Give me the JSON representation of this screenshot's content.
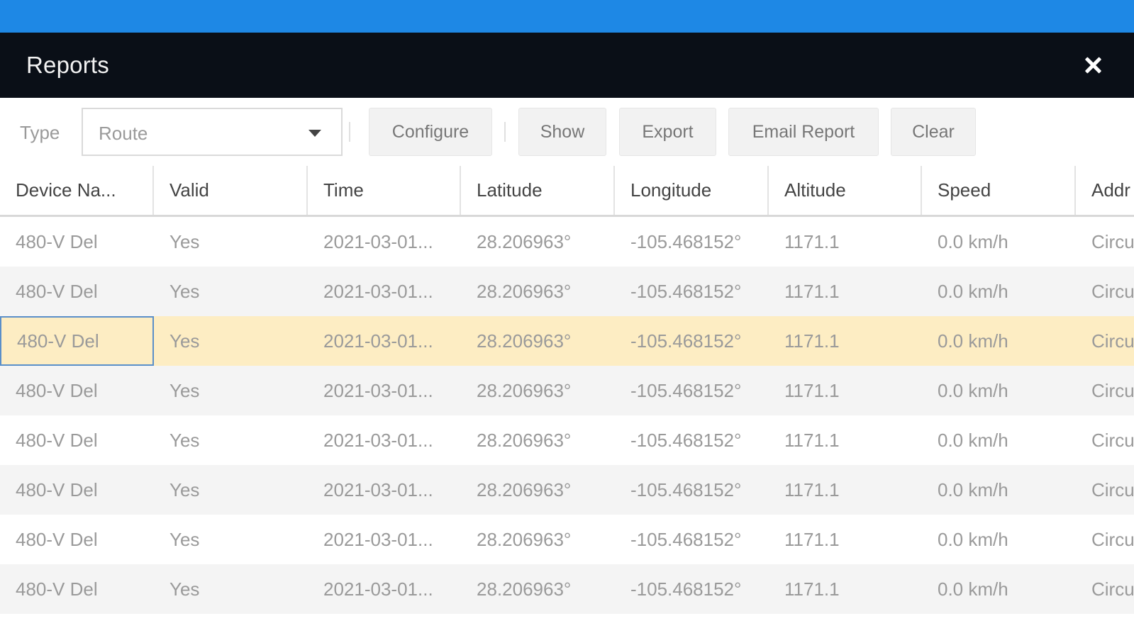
{
  "window": {
    "title": "Reports",
    "close_icon": "close-icon"
  },
  "toolbar": {
    "type_label": "Type",
    "type_select": {
      "value": "Route"
    },
    "buttons": {
      "configure": "Configure",
      "show": "Show",
      "export": "Export",
      "email_report": "Email Report",
      "clear": "Clear"
    }
  },
  "colors": {
    "top_bar": "#1e88e5",
    "title_bar": "#0a0f17",
    "selected_row": "#fdedc3"
  },
  "table": {
    "columns": [
      "Device Na...",
      "Valid",
      "Time",
      "Latitude",
      "Longitude",
      "Altitude",
      "Speed",
      "Addr"
    ],
    "rows": [
      [
        "480-V Del",
        "Yes",
        "2021-03-01...",
        "28.206963°",
        "-105.468152°",
        "1171.1",
        "0.0 km/h",
        "Circu"
      ],
      [
        "480-V Del",
        "Yes",
        "2021-03-01...",
        "28.206963°",
        "-105.468152°",
        "1171.1",
        "0.0 km/h",
        "Circu"
      ],
      [
        "480-V Del",
        "Yes",
        "2021-03-01...",
        "28.206963°",
        "-105.468152°",
        "1171.1",
        "0.0 km/h",
        "Circu"
      ],
      [
        "480-V Del",
        "Yes",
        "2021-03-01...",
        "28.206963°",
        "-105.468152°",
        "1171.1",
        "0.0 km/h",
        "Circu"
      ],
      [
        "480-V Del",
        "Yes",
        "2021-03-01...",
        "28.206963°",
        "-105.468152°",
        "1171.1",
        "0.0 km/h",
        "Circu"
      ],
      [
        "480-V Del",
        "Yes",
        "2021-03-01...",
        "28.206963°",
        "-105.468152°",
        "1171.1",
        "0.0 km/h",
        "Circu"
      ],
      [
        "480-V Del",
        "Yes",
        "2021-03-01...",
        "28.206963°",
        "-105.468152°",
        "1171.1",
        "0.0 km/h",
        "Circu"
      ],
      [
        "480-V Del",
        "Yes",
        "2021-03-01...",
        "28.206963°",
        "-105.468152°",
        "1171.1",
        "0.0 km/h",
        "Circu"
      ]
    ],
    "selected_row": 2,
    "focused_cell": [
      2,
      0
    ]
  }
}
